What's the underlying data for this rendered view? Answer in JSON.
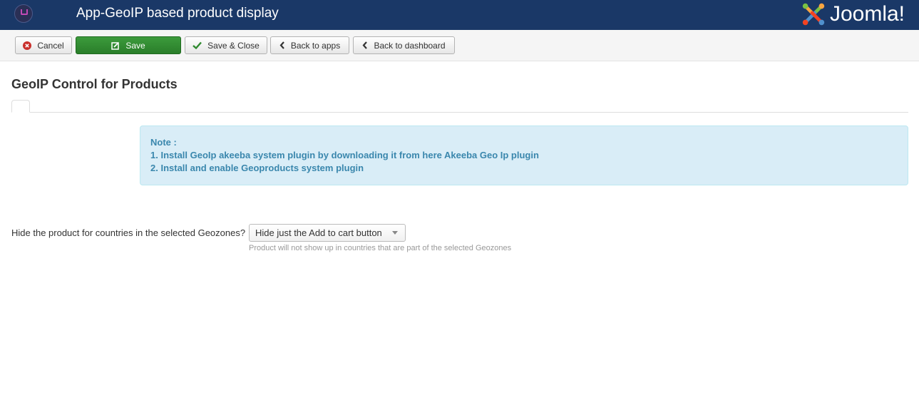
{
  "header": {
    "title": "App-GeoIP based product display",
    "brand": "Joomla!",
    "app_icon": "cart-icon"
  },
  "toolbar": {
    "cancel": "Cancel",
    "save": "Save",
    "save_close": "Save & Close",
    "back_apps": "Back to apps",
    "back_dashboard": "Back to dashboard"
  },
  "main": {
    "heading": "GeoIP Control for Products",
    "note": {
      "title": "Note :",
      "line1": "1. Install GeoIp akeeba system plugin by downloading it from here Akeeba Geo Ip plugin",
      "line2": "2. Install and enable Geoproducts system plugin"
    },
    "field": {
      "label": "Hide the product for countries in the selected Geozones?",
      "value": "Hide just the Add to cart button",
      "help": "Product will not show up in countries that are part of the selected Geozones"
    }
  },
  "colors": {
    "header_bg": "#1a3867",
    "save_green": "#2f8a2f",
    "note_bg": "#d9edf7",
    "note_text": "#3a87ad",
    "cancel_red": "#c9302c"
  }
}
